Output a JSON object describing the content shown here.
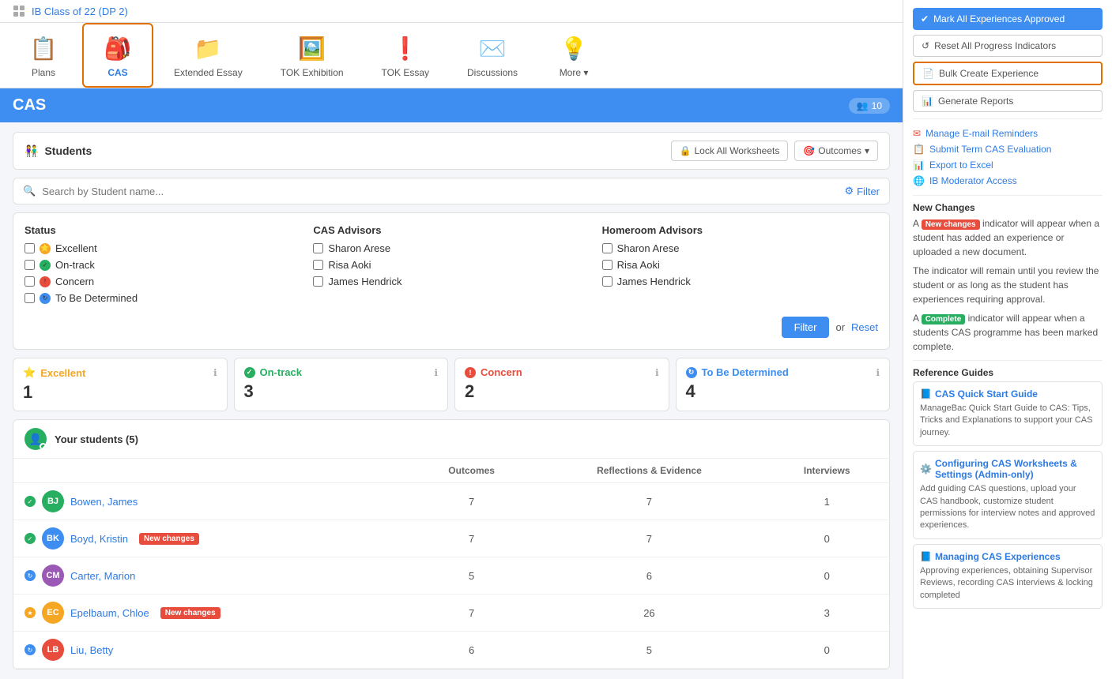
{
  "breadcrumb": {
    "class_name": "IB Class of 22 (DP 2)"
  },
  "nav": {
    "tabs": [
      {
        "id": "plans",
        "label": "Plans",
        "icon": "📋",
        "active": false
      },
      {
        "id": "cas",
        "label": "CAS",
        "icon": "🎒",
        "active": true
      },
      {
        "id": "extended-essay",
        "label": "Extended Essay",
        "icon": "📁",
        "active": false
      },
      {
        "id": "tok-exhibition",
        "label": "TOK Exhibition",
        "icon": "🖼️",
        "active": false
      },
      {
        "id": "tok-essay",
        "label": "TOK Essay",
        "icon": "❗",
        "active": false
      },
      {
        "id": "discussions",
        "label": "Discussions",
        "icon": "✉️",
        "active": false
      },
      {
        "id": "more",
        "label": "More",
        "icon": "💡",
        "active": false,
        "dropdown": true
      }
    ]
  },
  "cas_header": {
    "title": "CAS",
    "student_count": "10",
    "student_count_label": "10"
  },
  "students_bar": {
    "title": "Students",
    "lock_btn": "Lock All Worksheets",
    "outcomes_btn": "Outcomes"
  },
  "search": {
    "placeholder": "Search by Student name..."
  },
  "filter": {
    "filter_btn": "Filter",
    "status_title": "Status",
    "cas_advisors_title": "CAS Advisors",
    "homeroom_advisors_title": "Homeroom Advisors",
    "statuses": [
      {
        "id": "excellent",
        "label": "Excellent",
        "color": "excellent"
      },
      {
        "id": "ontrack",
        "label": "On-track",
        "color": "ontrack"
      },
      {
        "id": "concern",
        "label": "Concern",
        "color": "concern"
      },
      {
        "id": "tbd",
        "label": "To Be Determined",
        "color": "tbd"
      }
    ],
    "cas_advisors": [
      "Sharon Arese",
      "Risa Aoki",
      "James Hendrick"
    ],
    "homeroom_advisors": [
      "Sharon Arese",
      "Risa Aoki",
      "James Hendrick"
    ],
    "apply_btn": "Filter",
    "reset_btn": "Reset"
  },
  "status_summary": [
    {
      "id": "excellent",
      "label": "Excellent",
      "count": "1",
      "color": "excellent"
    },
    {
      "id": "ontrack",
      "label": "On-track",
      "count": "3",
      "color": "ontrack"
    },
    {
      "id": "concern",
      "label": "Concern",
      "count": "2",
      "color": "concern"
    },
    {
      "id": "tbd",
      "label": "To Be Determined",
      "count": "4",
      "color": "tbd"
    }
  ],
  "students_table": {
    "header": "Your students (5)",
    "columns": [
      "",
      "Outcomes",
      "Reflections & Evidence",
      "Interviews"
    ],
    "rows": [
      {
        "id": 1,
        "name": "Bowen, James",
        "status": "ontrack",
        "avatar_initials": "BJ",
        "avatar_color": "av-green",
        "new_changes": false,
        "outcomes": "7",
        "reflections": "7",
        "interviews": "1"
      },
      {
        "id": 2,
        "name": "Boyd, Kristin",
        "status": "ontrack",
        "avatar_initials": "BK",
        "avatar_color": "av-blue",
        "new_changes": true,
        "outcomes": "7",
        "reflections": "7",
        "interviews": "0"
      },
      {
        "id": 3,
        "name": "Carter, Marion",
        "status": "tbd",
        "avatar_initials": "CM",
        "avatar_color": "av-purple",
        "new_changes": false,
        "outcomes": "5",
        "reflections": "6",
        "interviews": "0"
      },
      {
        "id": 4,
        "name": "Epelbaum, Chloe",
        "status": "excellent",
        "avatar_initials": "EC",
        "avatar_color": "av-orange",
        "new_changes": true,
        "outcomes": "7",
        "reflections": "26",
        "interviews": "3"
      },
      {
        "id": 5,
        "name": "Liu, Betty",
        "status": "tbd",
        "avatar_initials": "LB",
        "avatar_color": "av-red",
        "new_changes": false,
        "outcomes": "6",
        "reflections": "5",
        "interviews": "0"
      }
    ]
  },
  "sidebar": {
    "mark_approved_btn": "Mark All Experiences Approved",
    "reset_progress_btn": "Reset All Progress Indicators",
    "bulk_create_btn": "Bulk Create Experience",
    "generate_reports_btn": "Generate Reports",
    "links": [
      {
        "id": "manage-email",
        "label": "Manage E-mail Reminders",
        "color": "red"
      },
      {
        "id": "submit-term",
        "label": "Submit Term CAS Evaluation",
        "color": "red"
      },
      {
        "id": "export-excel",
        "label": "Export to Excel",
        "color": "green"
      },
      {
        "id": "ib-moderator",
        "label": "IB Moderator Access",
        "color": "blue"
      }
    ],
    "new_changes_title": "New Changes",
    "new_changes_text1": "indicator will appear when a student has added an experience or uploaded a new document.",
    "new_changes_text2": "The indicator will remain until you review the student or as long as the student has experiences requiring approval.",
    "new_changes_text3": "indicator will appear when a students CAS programme has been marked complete.",
    "reference_guides_title": "Reference Guides",
    "guides": [
      {
        "id": "quick-start",
        "title": "CAS Quick Start Guide",
        "desc": "ManageBac Quick Start Guide to CAS: Tips, Tricks and Explanations to support your CAS journey."
      },
      {
        "id": "worksheets-settings",
        "title": "Configuring CAS Worksheets & Settings (Admin-only)",
        "desc": "Add guiding CAS questions, upload your CAS handbook, customize student permissions for interview notes and approved experiences."
      },
      {
        "id": "managing-experiences",
        "title": "Managing CAS Experiences",
        "desc": "Approving experiences, obtaining Supervisor Reviews, recording CAS interviews & locking completed"
      }
    ]
  }
}
